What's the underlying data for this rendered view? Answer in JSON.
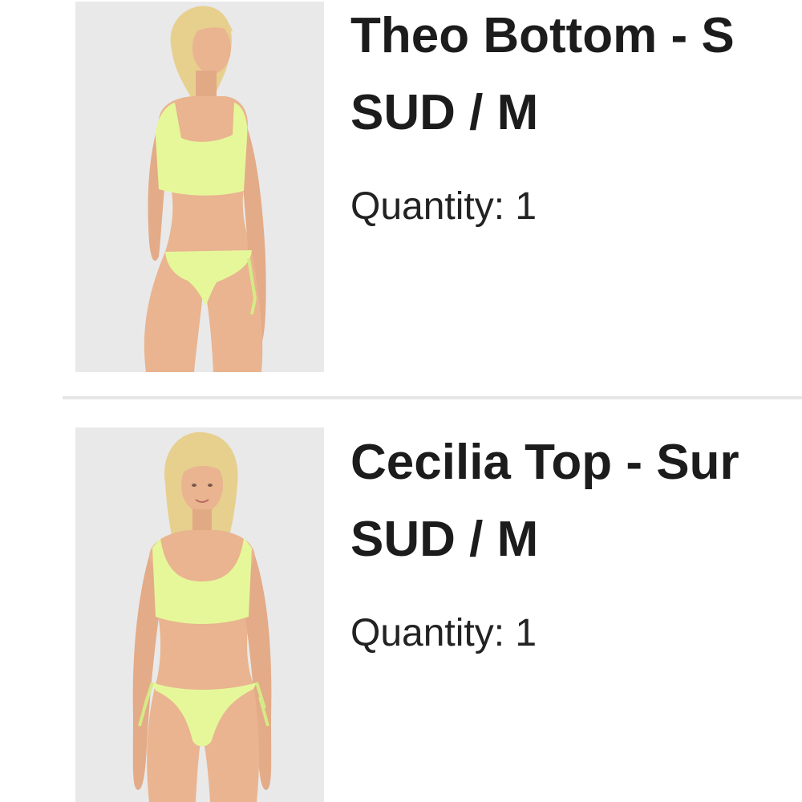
{
  "cart_items": [
    {
      "name": "Theo Bottom - S",
      "variant": "SUD / M",
      "quantity_label": "Quantity: 1",
      "image": "model-back-view-lime-bikini"
    },
    {
      "name": "Cecilia Top - Sur",
      "variant": "SUD / M",
      "quantity_label": "Quantity: 1",
      "image": "model-front-view-lime-bikini"
    }
  ],
  "colors": {
    "swimwear": "#e6f79a",
    "skin": "#e9b48f",
    "hair": "#e7cf8e",
    "image_background": "#e9e9ea"
  }
}
